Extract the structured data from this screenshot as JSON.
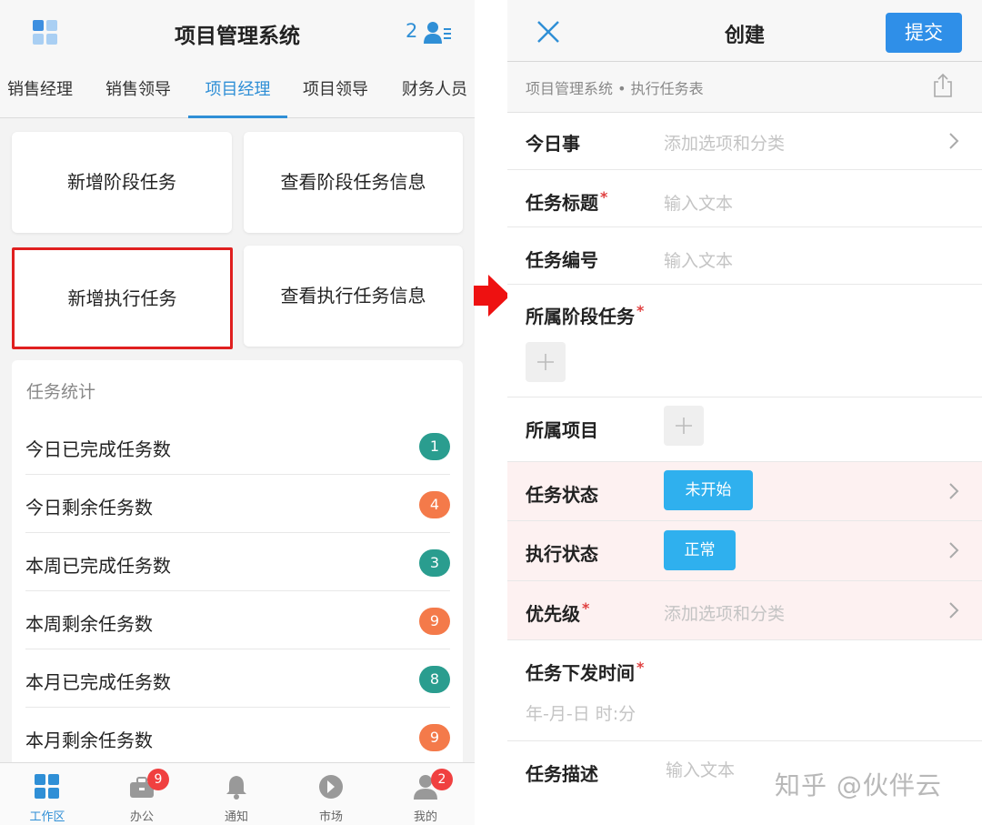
{
  "left": {
    "header": {
      "title": "项目管理系统",
      "user_count": "2"
    },
    "roles": [
      "销售经理",
      "销售领导",
      "项目经理",
      "项目领导",
      "财务人员"
    ],
    "cards": [
      "新增阶段任务",
      "查看阶段任务信息",
      "新增执行任务",
      "查看执行任务信息"
    ],
    "stats": {
      "title": "任务统计",
      "rows": [
        {
          "label": "今日已完成任务数",
          "value": "1",
          "color": "#2a9d8f"
        },
        {
          "label": "今日剩余任务数",
          "value": "4",
          "color": "#f47a4a"
        },
        {
          "label": "本周已完成任务数",
          "value": "3",
          "color": "#2a9d8f"
        },
        {
          "label": "本周剩余任务数",
          "value": "9",
          "color": "#f47a4a"
        },
        {
          "label": "本月已完成任务数",
          "value": "8",
          "color": "#2a9d8f"
        },
        {
          "label": "本月剩余任务数",
          "value": "9",
          "color": "#f47a4a"
        }
      ]
    },
    "tabbar": [
      {
        "label": "工作区",
        "icon": "grid-icon",
        "badge": ""
      },
      {
        "label": "办公",
        "icon": "briefcase-icon",
        "badge": "9"
      },
      {
        "label": "通知",
        "icon": "bell-icon",
        "badge": ""
      },
      {
        "label": "市场",
        "icon": "compass-icon",
        "badge": ""
      },
      {
        "label": "我的",
        "icon": "person-icon",
        "badge": "2"
      }
    ]
  },
  "right": {
    "header": {
      "title": "创建",
      "submit_label": "提交"
    },
    "breadcrumb": "项目管理系统 • 执行任务表",
    "fields": {
      "today": {
        "label": "今日事",
        "placeholder": "添加选项和分类"
      },
      "task_title": {
        "label": "任务标题",
        "placeholder": "输入文本"
      },
      "task_number": {
        "label": "任务编号",
        "placeholder": "输入文本"
      },
      "stage_task": {
        "label": "所属阶段任务"
      },
      "project": {
        "label": "所属项目"
      },
      "task_status": {
        "label": "任务状态",
        "value": "未开始"
      },
      "exec_status": {
        "label": "执行状态",
        "value": "正常"
      },
      "priority": {
        "label": "优先级",
        "placeholder": "添加选项和分类"
      },
      "issue_time": {
        "label": "任务下发时间",
        "placeholder": "年-月-日 时:分"
      },
      "description": {
        "label": "任务描述",
        "placeholder": "输入文本"
      }
    },
    "required_mark": "*"
  },
  "watermark": "知乎 @伙伴云",
  "colors": {
    "accent": "#2f8fd6",
    "highlight_border": "#e02020",
    "arrow": "#ee1111"
  }
}
